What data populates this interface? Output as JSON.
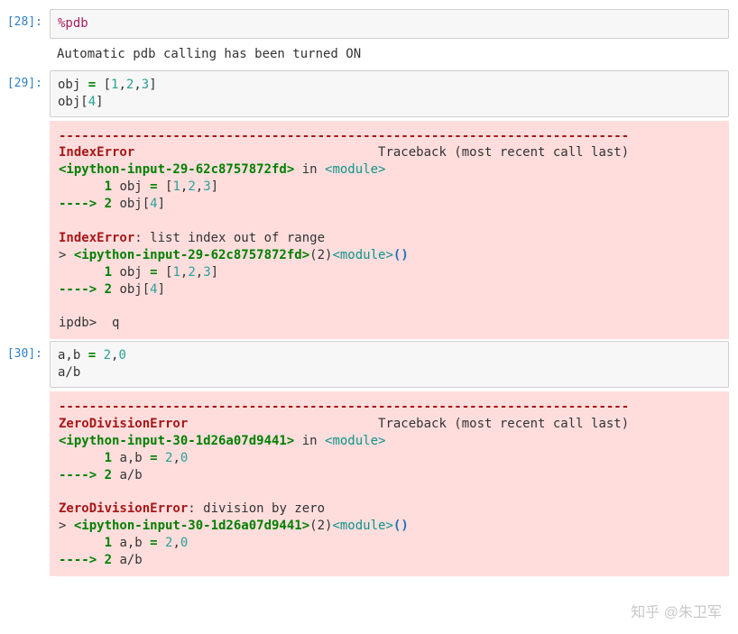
{
  "cells": {
    "c28": {
      "prompt": "[28]:",
      "code": {
        "tokens": [
          {
            "t": "%pdb",
            "c": "c-mag"
          }
        ]
      },
      "stream": "Automatic pdb calling has been turned ON"
    },
    "c29": {
      "prompt": "[29]:",
      "code_line1": {
        "pre": "obj ",
        "op": "=",
        "post": " [",
        "n1": "1",
        "c1": ",",
        "n2": "2",
        "c2": ",",
        "n3": "3",
        "end": "]"
      },
      "code_line2": {
        "pre": "obj[",
        "n": "4",
        "post": "]"
      },
      "err": {
        "dash": "---------------------------------------------------------------------------",
        "name": "IndexError",
        "tb_label": "Traceback (most recent call last)",
        "src_lt": "<ipython-input-29-62c8757872fd>",
        "in": " in ",
        "module": "<module>",
        "l1_no": "1",
        "l1": {
          "pre": " obj ",
          "eq": "=",
          "post": " [",
          "n1": "1",
          "c1": ",",
          "n2": "2",
          "c2": ",",
          "n3": "3",
          "end": "]"
        },
        "arrow": "----> ",
        "l2_no": "2",
        "l2": {
          "pre": " obj[",
          "n": "4",
          "post": "]"
        },
        "msg_pre": "IndexError",
        "msg": ": list index out of range",
        "pdb_line_pre": "> ",
        "pdb_src": "<ipython-input-29-62c8757872fd>",
        "pdb_paren": "(2)",
        "pdb_mod": "<module>",
        "pdb_call": "()",
        "ipdb_prompt": "ipdb>  q"
      }
    },
    "c30": {
      "prompt": "[30]:",
      "code_line1": {
        "pre": "a,b ",
        "eq": "=",
        "post": " ",
        "n1": "2",
        "c1": ",",
        "n2": "0"
      },
      "code_line2": "a/b",
      "err": {
        "dash": "---------------------------------------------------------------------------",
        "name": "ZeroDivisionError",
        "tb_label": "Traceback (most recent call last)",
        "src_lt": "<ipython-input-30-1d26a07d9441>",
        "in": " in ",
        "module": "<module>",
        "l1_no": "1",
        "l1": {
          "pre": " a,b ",
          "eq": "=",
          "post": " ",
          "n1": "2",
          "c1": ",",
          "n2": "0"
        },
        "arrow": "----> ",
        "l2_no": "2",
        "l2_body": " a/b",
        "msg_pre": "ZeroDivisionError",
        "msg": ": division by zero",
        "pdb_line_pre": "> ",
        "pdb_src": "<ipython-input-30-1d26a07d9441>",
        "pdb_paren": "(2)",
        "pdb_mod": "<module>",
        "pdb_call": "()"
      }
    }
  },
  "watermark": "知乎 @朱卫军"
}
